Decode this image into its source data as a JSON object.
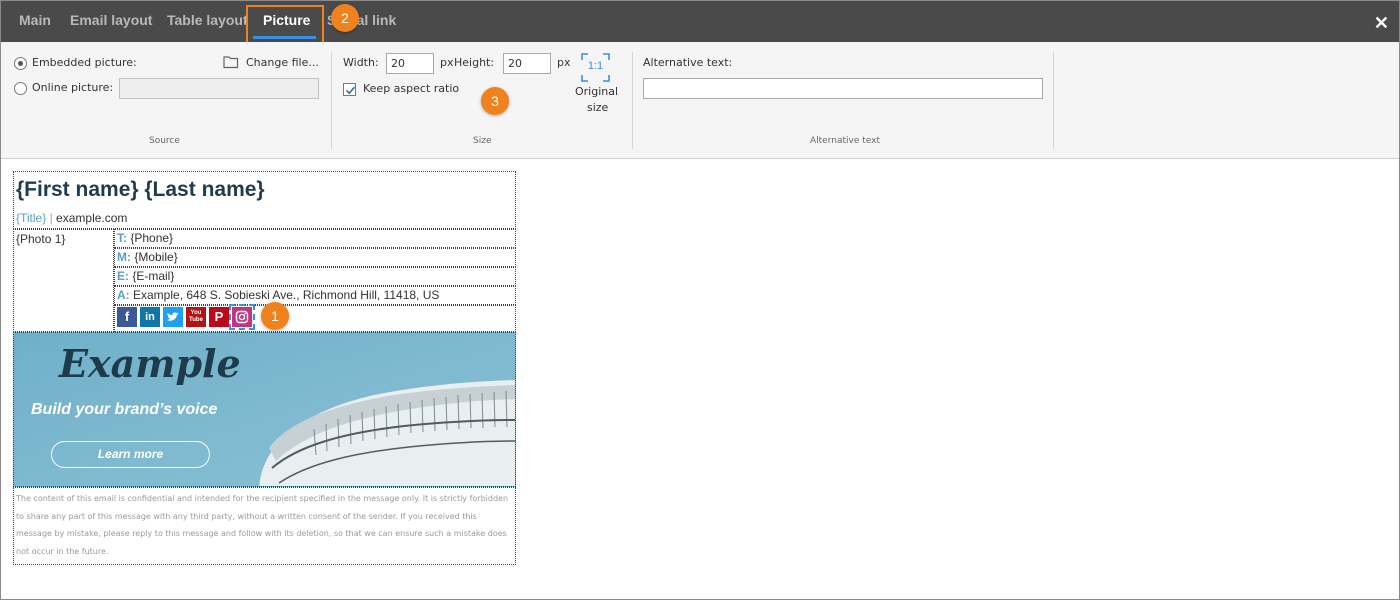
{
  "tabs": [
    {
      "label": "Main",
      "active": false
    },
    {
      "label": "Email layout",
      "active": false
    },
    {
      "label": "Table layout",
      "active": false
    },
    {
      "label": "Picture",
      "active": true
    },
    {
      "label": "Social link",
      "active": false
    }
  ],
  "close_label": "✕",
  "annotations": [
    "1",
    "2",
    "3"
  ],
  "ribbon": {
    "source": {
      "embedded_label": "Embedded picture:",
      "embedded_selected": true,
      "online_label": "Online picture:",
      "online_value": "",
      "change_file_label": "Change file...",
      "group_title": "Source"
    },
    "size": {
      "width_label": "Width:",
      "width_value": "20",
      "px_label": "px",
      "height_label": "Height:",
      "height_value": "20",
      "keep_aspect_label": "Keep aspect ratio",
      "keep_aspect_checked": true,
      "original_icon_text": "1:1",
      "original_label_line1": "Original",
      "original_label_line2": "size",
      "group_title": "Size"
    },
    "alt": {
      "label": "Alternative text:",
      "value": "",
      "group_title": "Alternative text"
    }
  },
  "signature": {
    "name": "{First name} {Last name}",
    "title": "{Title}",
    "separator": " | ",
    "domain": "example.com",
    "photo": "{Photo 1}",
    "contacts": [
      {
        "key": "T:",
        "value": " {Phone}"
      },
      {
        "key": "M:",
        "value": " {Mobile}"
      },
      {
        "key": "E:",
        "value": " {E-mail}"
      },
      {
        "key": "A:",
        "value": " Example, 648 S. Sobieski Ave., Richmond Hill, 11418, US"
      }
    ],
    "social_icons": [
      {
        "name": "facebook-icon",
        "glyph": "f",
        "color": "#3b5998"
      },
      {
        "name": "linkedin-icon",
        "glyph": "in",
        "color": "#0e76a8"
      },
      {
        "name": "twitter-icon",
        "glyph": "",
        "color": "#1da1f2"
      },
      {
        "name": "youtube-icon",
        "glyph": "You Tube",
        "color": "#b31217"
      },
      {
        "name": "pinterest-icon",
        "glyph": "P",
        "color": "#bd081c"
      },
      {
        "name": "instagram-icon",
        "glyph": "",
        "color": "#c13584"
      }
    ],
    "banner": {
      "logo_text": "Example",
      "tagline": "Build your brand’s voice",
      "button": "Learn more"
    },
    "disclaimer": "The content of this email is confidential and intended for the recipient specified in the message only. It is strictly forbidden to share any part of this message with any third party, without a written consent of the sender. If you received this message by mistake, please reply to this message and follow with its deletion, so that we can ensure such a mistake does not occur in the future."
  },
  "colors": {
    "accent": "#3b8fe6",
    "annotation": "#f0821e",
    "tabbar": "#4a4a4a",
    "heading": "#1f3b4d",
    "label_blue": "#5aa1c2"
  }
}
